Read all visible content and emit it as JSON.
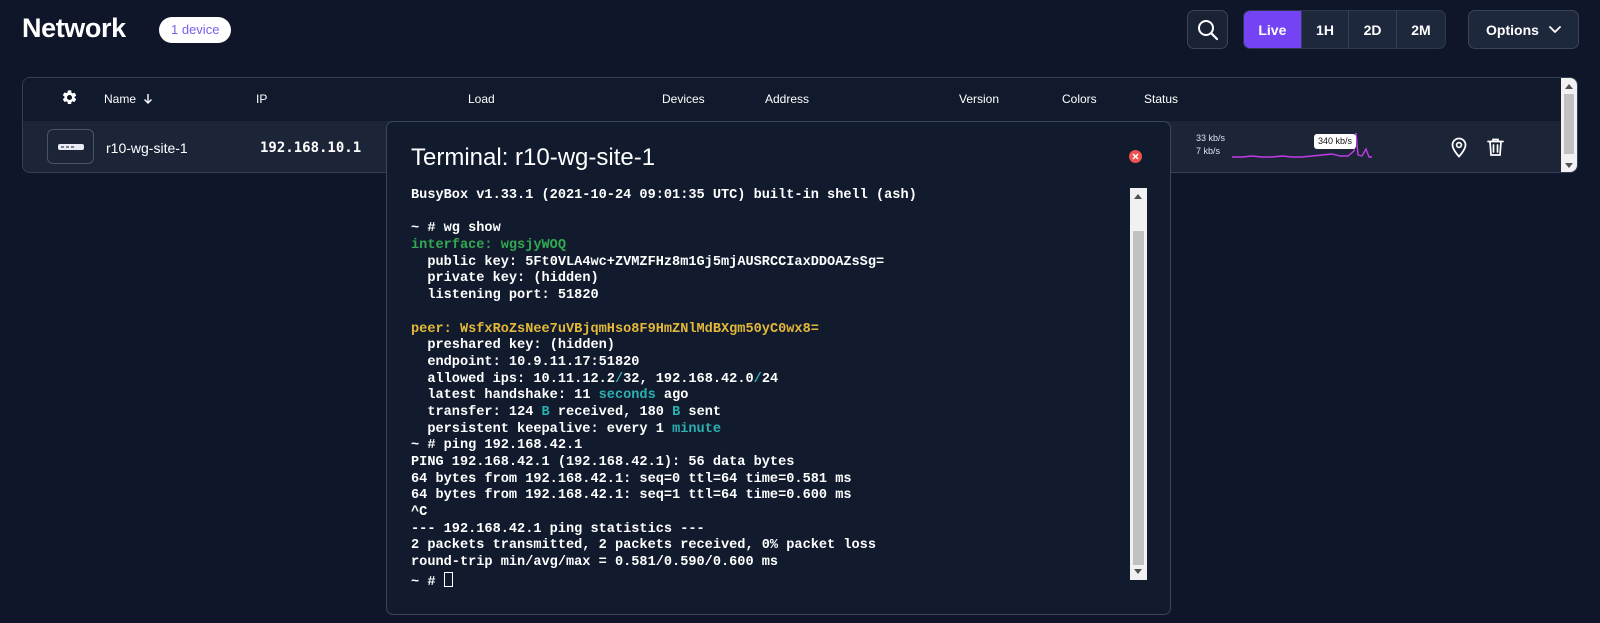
{
  "header": {
    "title": "Network",
    "device_badge": "1 device",
    "ranges": [
      "Live",
      "1H",
      "2D",
      "2M"
    ],
    "active_range": "Live",
    "options_label": "Options"
  },
  "table": {
    "columns": {
      "name": "Name",
      "ip": "IP",
      "load": "Load",
      "devices": "Devices",
      "address": "Address",
      "version": "Version",
      "colors": "Colors",
      "status": "Status"
    },
    "rows": [
      {
        "name": "r10-wg-site-1",
        "ip": "192.168.10.1",
        "rate_up": "33 kb/s",
        "rate_down": "7 kb/s",
        "peak_label": "340 kb/s"
      }
    ]
  },
  "terminal": {
    "title": "Terminal: r10-wg-site-1",
    "lines": [
      [
        [
          "BusyBox v1.33.1 (2021-10-24 09:01:35 UTC) built-in shell (ash)",
          ""
        ]
      ],
      [],
      [
        [
          "~ # wg show",
          ""
        ]
      ],
      [
        [
          "interface: ",
          "c-green"
        ],
        [
          "wgsjyWOQ",
          "c-green"
        ]
      ],
      [
        [
          "  public key: ",
          ""
        ],
        [
          "5Ft0VLA4wc+ZVMZFHz8m1Gj5mjAUSRCCIaxDDOAZsSg=",
          ""
        ]
      ],
      [
        [
          "  private key: ",
          ""
        ],
        [
          "(hidden)",
          ""
        ]
      ],
      [
        [
          "  listening port: ",
          ""
        ],
        [
          "51820",
          ""
        ]
      ],
      [],
      [
        [
          "peer: ",
          "c-yellow"
        ],
        [
          "WsfxRoZsNee7uVBjqmHso8F9HmZNlMdBXgm50yC0wx8=",
          "c-yellow"
        ]
      ],
      [
        [
          "  preshared key: ",
          ""
        ],
        [
          "(hidden)",
          ""
        ]
      ],
      [
        [
          "  endpoint: ",
          ""
        ],
        [
          "10.9.11.17:51820",
          ""
        ]
      ],
      [
        [
          "  allowed ips: ",
          ""
        ],
        [
          "10.11.12.2",
          ""
        ],
        [
          "/",
          "c-teal"
        ],
        [
          "32, 192.168.42.0",
          ""
        ],
        [
          "/",
          "c-teal"
        ],
        [
          "24",
          ""
        ]
      ],
      [
        [
          "  latest handshake: ",
          ""
        ],
        [
          "11 ",
          ""
        ],
        [
          "seconds",
          "c-teal"
        ],
        [
          " ago",
          ""
        ]
      ],
      [
        [
          "  transfer: ",
          ""
        ],
        [
          "124 ",
          ""
        ],
        [
          "B",
          "c-teal"
        ],
        [
          " received, 180 ",
          ""
        ],
        [
          "B",
          "c-teal"
        ],
        [
          " sent",
          ""
        ]
      ],
      [
        [
          "  persistent keepalive: ",
          ""
        ],
        [
          "every 1 ",
          ""
        ],
        [
          "minute",
          "c-teal"
        ]
      ],
      [
        [
          "~ # ping 192.168.42.1",
          ""
        ]
      ],
      [
        [
          "PING 192.168.42.1 (192.168.42.1): 56 data bytes",
          ""
        ]
      ],
      [
        [
          "64 bytes from 192.168.42.1: seq=0 ttl=64 time=0.581 ms",
          ""
        ]
      ],
      [
        [
          "64 bytes from 192.168.42.1: seq=1 ttl=64 time=0.600 ms",
          ""
        ]
      ],
      [
        [
          "^C",
          ""
        ]
      ],
      [
        [
          "--- 192.168.42.1 ping statistics ---",
          ""
        ]
      ],
      [
        [
          "2 packets transmitted, 2 packets received, 0% packet loss",
          ""
        ]
      ],
      [
        [
          "round-trip min/avg/max = 0.581/0.590/0.600 ms",
          ""
        ]
      ],
      [
        [
          "~ # ",
          ""
        ]
      ]
    ]
  },
  "colors": {
    "background": "#0f1629",
    "accent": "#7444f4",
    "sparkline": "#c03ce6",
    "interface_green": "#32a852",
    "peer_yellow": "#e3b83a",
    "unit_teal": "#2bb0b0",
    "close_red": "#ef5350"
  },
  "icons": {
    "search": "search-icon",
    "chevron": "chevron-down-icon",
    "gear": "gear-icon",
    "sort": "arrow-down-icon",
    "router": "router-icon",
    "location": "location-pin-icon",
    "delete": "trash-icon",
    "close": "close-icon"
  }
}
